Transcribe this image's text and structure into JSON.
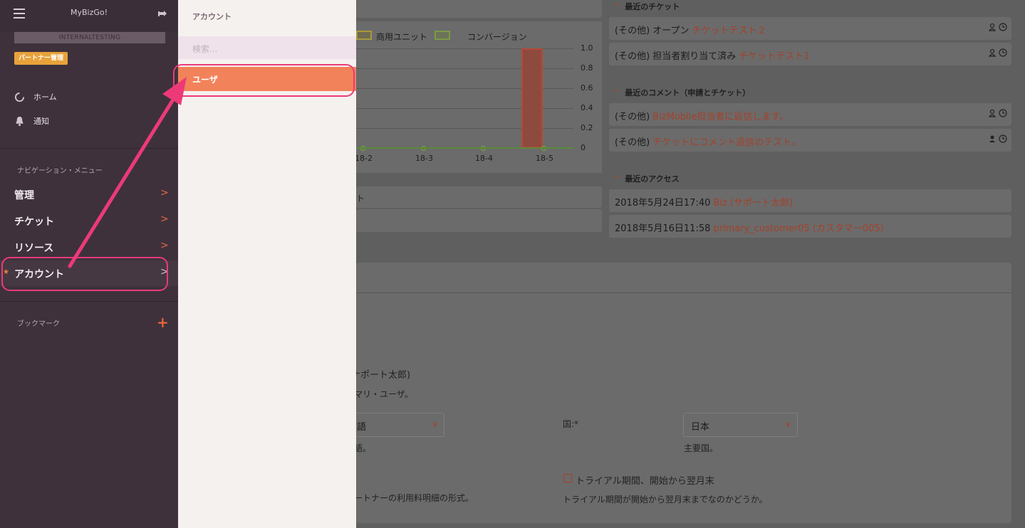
{
  "sidebar": {
    "app_title": "MyBizGo!",
    "tenant": "INTERNALTESTING",
    "partner_badge": "パートナー管理",
    "home": "ホーム",
    "notifications": "通知",
    "nav_section": "ナビゲーション・メニュー",
    "items": [
      {
        "label": "管理"
      },
      {
        "label": "チケット"
      },
      {
        "label": "リソース"
      },
      {
        "label": "アカウント"
      }
    ],
    "bookmarks": "ブックマーク",
    "icons": [
      "menu-icon",
      "pin-icon",
      "loading-icon",
      "bell-icon",
      "chevron-right-icon",
      "star-icon",
      "plus-icon"
    ]
  },
  "flyout": {
    "title": "アカウント",
    "search_placeholder": "検索...",
    "items": [
      {
        "label": "ユーザ"
      }
    ]
  },
  "chart": {
    "chart_data": {
      "type": "bar",
      "categories": [
        "18-2",
        "18-3",
        "18-4",
        "18-5"
      ],
      "series": [
        {
          "name": "商用ユニット",
          "values": [
            0,
            0,
            0,
            1.0
          ]
        },
        {
          "name": "コンバージョン",
          "values": [
            0,
            0,
            0,
            0
          ]
        }
      ],
      "yticks": [
        "1.0",
        "0.8",
        "0.6",
        "0.4",
        "0.2",
        "0"
      ],
      "ylim": [
        0,
        1.0
      ]
    }
  },
  "recent_tickets": {
    "header": "最近のチケット",
    "rows": [
      {
        "prefix": "(その他) オープン ",
        "link": "チケットテスト２"
      },
      {
        "prefix": "(その他) 担当者割り当て済み ",
        "link": "チケットテスト1"
      }
    ]
  },
  "recent_comments": {
    "header": "最近のコメント（申請とチケット）",
    "rows": [
      {
        "prefix": "(その他) ",
        "link": "BizMobile担当者に返信します。"
      },
      {
        "prefix": "(その他) ",
        "link": "チケットにコメント返信のテスト。"
      }
    ]
  },
  "recent_access": {
    "header": "最近のアクセス",
    "rows": [
      {
        "prefix": "2018年5月24日17:40 ",
        "link": "Biz (サポート太郎)"
      },
      {
        "prefix": "2018年5月16日11:58 ",
        "link": "primary_customer05 (カスタマー005)"
      }
    ]
  },
  "form": {
    "partial_t": "ト",
    "partial_user": "ナポート太郎)",
    "partial_primary": "マリ・ユーザ。",
    "lang_value": "語",
    "lang_help": "語。",
    "country_label": "国:*",
    "country_value": "日本",
    "country_help": "主要国。",
    "trial_label": "トライアル期間、開始から翌月末",
    "trial_help": "トライアル期間が開始から翌月末までなのかどうか。",
    "billing_help": "ートナーの利用料明細の形式。"
  }
}
